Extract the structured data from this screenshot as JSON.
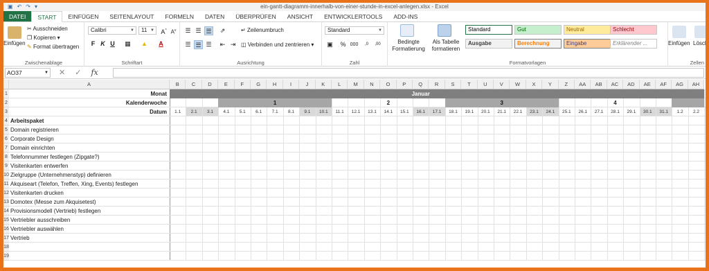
{
  "window": {
    "title": "ein-gantt-diagramm-innerhalb-von-einer-stunde-in-excel-anlegen.xlsx - Excel"
  },
  "tabs": [
    "DATEI",
    "START",
    "EINFÜGEN",
    "SEITENLAYOUT",
    "FORMELN",
    "DATEN",
    "ÜBERPRÜFEN",
    "ANSICHT",
    "ENTWICKLERTOOLS",
    "ADD-INS"
  ],
  "ribbon": {
    "clipboard": {
      "paste": "Einfügen",
      "cut": "Ausschneiden",
      "copy": "Kopieren",
      "format_painter": "Format übertragen",
      "label": "Zwischenablage"
    },
    "font": {
      "name": "Calibri",
      "size": "11",
      "label": "Schriftart"
    },
    "alignment": {
      "wrap": "Zeilenumbruch",
      "merge": "Verbinden und zentrieren",
      "label": "Ausrichtung"
    },
    "number": {
      "format": "Standard",
      "label": "Zahl"
    },
    "styles": {
      "conditional": "Bedingte Formatierung",
      "as_table": "Als Tabelle formatieren",
      "label": "Formatvorlagen",
      "cells": [
        {
          "name": "Standard",
          "bg": "#ffffff",
          "fg": "#000000"
        },
        {
          "name": "Gut",
          "bg": "#c6efce",
          "fg": "#006100"
        },
        {
          "name": "Neutral",
          "bg": "#ffeb9c",
          "fg": "#9c6500"
        },
        {
          "name": "Schlecht",
          "bg": "#ffc7ce",
          "fg": "#9c0006"
        },
        {
          "name": "Ausgabe",
          "bg": "#f2f2f2",
          "fg": "#3f3f3f"
        },
        {
          "name": "Berechnung",
          "bg": "#f2f2f2",
          "fg": "#fa7d00"
        },
        {
          "name": "Eingabe",
          "bg": "#ffcc99",
          "fg": "#3f3f76"
        },
        {
          "name": "Erklärender ...",
          "bg": "#ffffff",
          "fg": "#7f7f7f"
        }
      ]
    },
    "cells_group": {
      "insert": "Einfügen",
      "delete": "Lösch",
      "label": "Zellen"
    }
  },
  "formula_bar": {
    "name_box": "AO37",
    "fx": "fx",
    "value": ""
  },
  "sheet": {
    "columns": [
      "A",
      "B",
      "C",
      "D",
      "E",
      "F",
      "G",
      "H",
      "I",
      "J",
      "K",
      "L",
      "M",
      "N",
      "O",
      "P",
      "Q",
      "R",
      "S",
      "T",
      "U",
      "V",
      "W",
      "X",
      "Y",
      "Z",
      "AA",
      "AB",
      "AC",
      "AD",
      "AE",
      "AF",
      "AG",
      "AH"
    ],
    "row_numbers": [
      "1",
      "2",
      "3",
      "4",
      "5",
      "6",
      "7",
      "8",
      "9",
      "10",
      "11",
      "12",
      "13",
      "14",
      "15",
      "16",
      "17",
      "18",
      "19"
    ],
    "labels": {
      "month": "Monat",
      "week": "Kalenderwoche",
      "date": "Datum",
      "package": "Arbeitspaket"
    },
    "month_name": "Januar",
    "weeks": [
      "1",
      "2",
      "3",
      "4"
    ],
    "dates": [
      "1.1",
      "2.1",
      "3.1",
      "4.1",
      "5.1",
      "6.1",
      "7.1",
      "8.1",
      "9.1",
      "10.1",
      "11.1",
      "12.1",
      "13.1",
      "14.1",
      "15.1",
      "16.1",
      "17.1",
      "18.1",
      "19.1",
      "20.1",
      "21.1",
      "22.1",
      "23.1",
      "24.1",
      "25.1",
      "26.1",
      "27.1",
      "28.1",
      "29.1",
      "30.1",
      "31.1",
      "1.2",
      "2.2"
    ],
    "weekend_dates": [
      "2.1",
      "3.1",
      "9.1",
      "10.1",
      "16.1",
      "17.1",
      "23.1",
      "24.1",
      "30.1",
      "31.1"
    ],
    "tasks": [
      "Domain registrieren",
      "Corporate Design",
      "Domain einrichten",
      "Telefonnummer festlegen (Zipgate?)",
      "Visitenkarten entwerfen",
      "Zielgruppe (Unternehmenstyp) definieren",
      "Akquiseart (Telefon, Treffen, Xing, Events) festlegen",
      "Visitenkarten drucken",
      "Domotex (Messe zum Akquisetest)",
      "Provisionsmodell (Vertrieb) festlegen",
      "Vertriebler ausschreiben",
      "Vertriebler auswählen",
      "Vertrieb"
    ]
  }
}
